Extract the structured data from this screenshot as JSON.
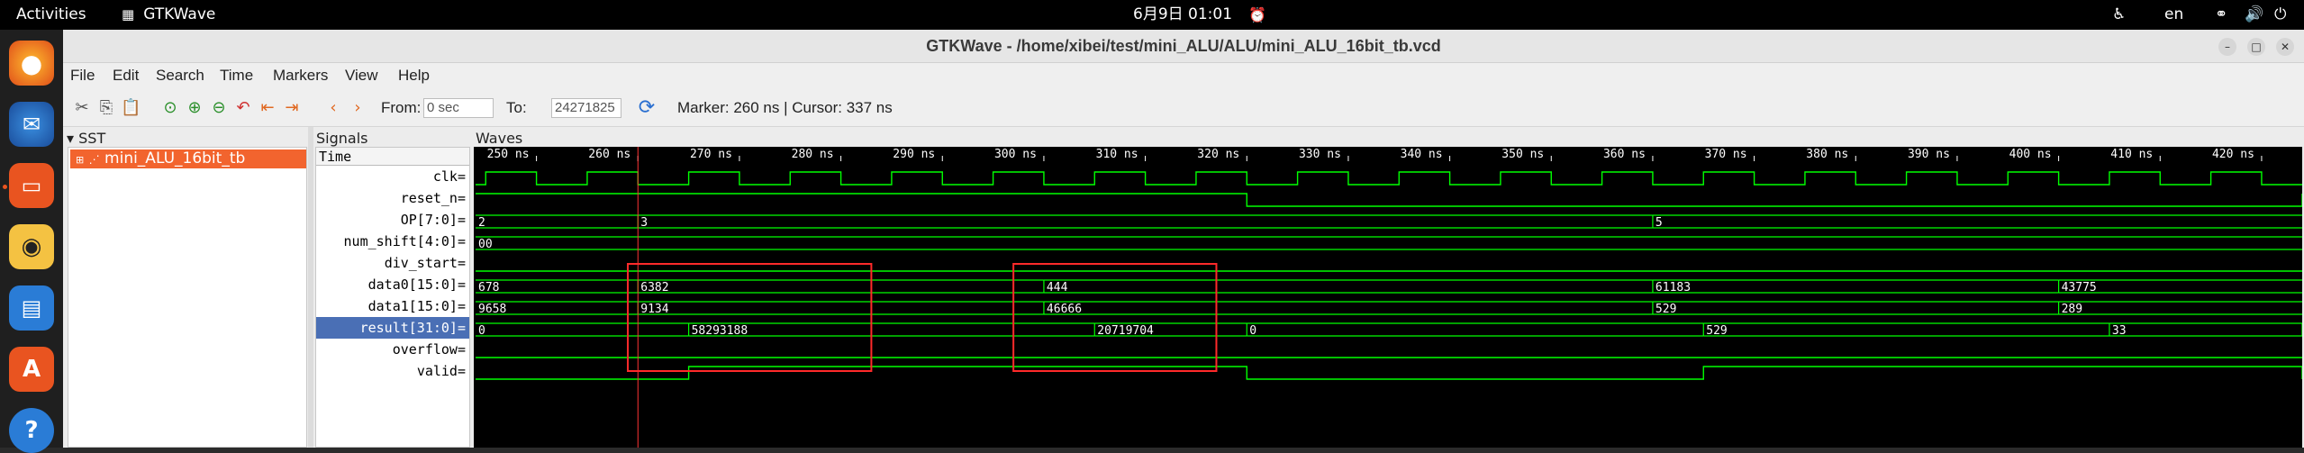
{
  "topbar": {
    "activities": "Activities",
    "app_name": "GTKWave",
    "clock": "6月9日  01:01",
    "lang": "en"
  },
  "window": {
    "title": "GTKWave - /home/xibei/test/mini_ALU/ALU/mini_ALU_16bit_tb.vcd"
  },
  "menu": [
    "File",
    "Edit",
    "Search",
    "Time",
    "Markers",
    "View",
    "Help"
  ],
  "toolbar": {
    "from_label": "From:",
    "from_value": "0 sec",
    "to_label": "To:",
    "to_value": "24271825",
    "marker_cursor": "Marker: 260 ns  |  Cursor: 337 ns"
  },
  "sst": {
    "header": "SST",
    "item": "mini_ALU_16bit_tb"
  },
  "signals": {
    "header": "Signals",
    "time_label": "Time",
    "rows": [
      "clk=",
      "reset_n=",
      "OP[7:0]=",
      "num_shift[4:0]=",
      "div_start=",
      "data0[15:0]=",
      "data1[15:0]=",
      "result[31:0]=",
      "overflow=",
      "valid="
    ],
    "selected_index": 7
  },
  "waves": {
    "header": "Waves",
    "time_ticks": [
      "250 ns",
      "260 ns",
      "270 ns",
      "280 ns",
      "290 ns",
      "300 ns",
      "310 ns",
      "320 ns",
      "330 ns",
      "340 ns",
      "350 ns",
      "360 ns",
      "370 ns",
      "380 ns",
      "390 ns",
      "400 ns",
      "410 ns",
      "420 ns"
    ],
    "t_start": 244,
    "t_end": 424,
    "marker_ns": 260,
    "clk_period_ns": 10,
    "clk_first_rise_ns": 245,
    "reset_n_fall_ns": 320,
    "reset_n_rise_ns": 424,
    "op": [
      {
        "t": 244,
        "v": "2"
      },
      {
        "t": 260,
        "v": "3"
      },
      {
        "t": 360,
        "v": "5"
      }
    ],
    "num_shift": [
      {
        "t": 244,
        "v": "00"
      }
    ],
    "data0": [
      {
        "t": 244,
        "v": "678"
      },
      {
        "t": 260,
        "v": "6382"
      },
      {
        "t": 300,
        "v": "444"
      },
      {
        "t": 360,
        "v": "61183"
      },
      {
        "t": 400,
        "v": "43775"
      }
    ],
    "data1": [
      {
        "t": 244,
        "v": "9658"
      },
      {
        "t": 260,
        "v": "9134"
      },
      {
        "t": 300,
        "v": "46666"
      },
      {
        "t": 360,
        "v": "529"
      },
      {
        "t": 400,
        "v": "289"
      }
    ],
    "result": [
      {
        "t": 244,
        "v": "0"
      },
      {
        "t": 265,
        "v": "58293188"
      },
      {
        "t": 305,
        "v": "20719704"
      },
      {
        "t": 320,
        "v": "0"
      },
      {
        "t": 365,
        "v": "529"
      },
      {
        "t": 405,
        "v": "33"
      },
      {
        "t": 424,
        "v": "0"
      }
    ],
    "valid_high": [
      [
        265,
        320
      ],
      [
        365,
        424
      ]
    ],
    "highlight_boxes_ns": [
      [
        259,
        283
      ],
      [
        297,
        317
      ]
    ],
    "colors": {
      "wave": "#00ff00",
      "background": "#000000",
      "marker": "#ff3333",
      "grid": "#1b5e2a",
      "box": "#ff2a2a"
    }
  }
}
